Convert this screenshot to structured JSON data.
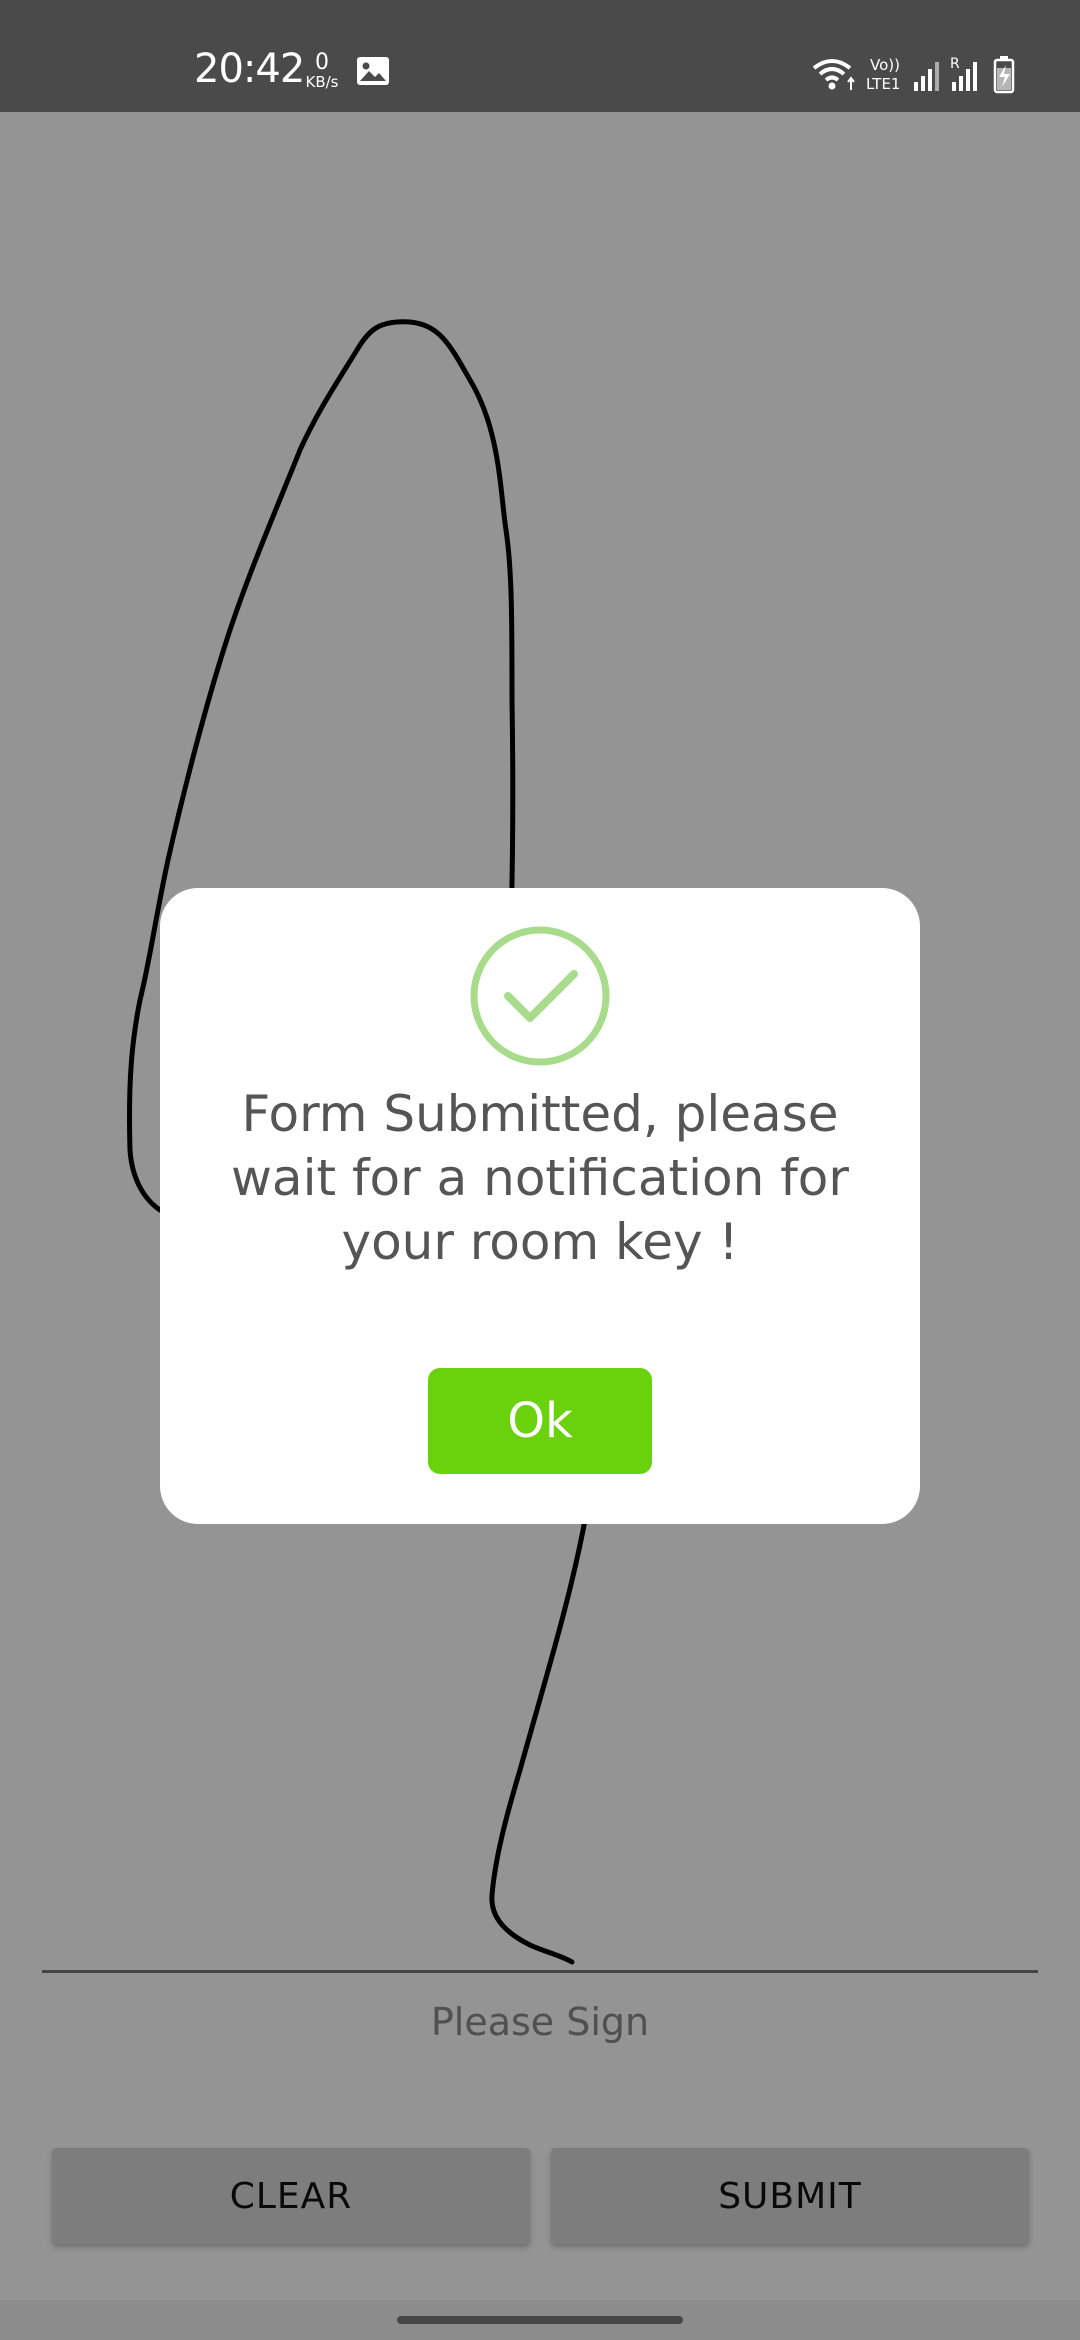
{
  "status_bar": {
    "time": "20:42",
    "net_speed_value": "0",
    "net_speed_unit": "KB/s",
    "icons": [
      "image-notification-icon",
      "wifi-icon",
      "volte-lte1-icon",
      "signal-sim1-icon",
      "signal-sim2-roaming-icon",
      "battery-charging-icon"
    ],
    "volte_label_top": "Vo))",
    "volte_label_bottom": "LTE1",
    "roaming_label": "R"
  },
  "signature": {
    "placeholder": "Please Sign"
  },
  "buttons": {
    "clear_label": "CLEAR",
    "submit_label": "SUBMIT"
  },
  "dialog": {
    "icon": "checkmark-circle-icon",
    "message": "Form Submitted, please wait for a notification for your room key !",
    "ok_label": "Ok"
  },
  "colors": {
    "status_bar": "#4a4a4a",
    "ok_button": "#6ad20c",
    "success_icon": "#a8dc8c",
    "dialog_text": "#555555"
  }
}
